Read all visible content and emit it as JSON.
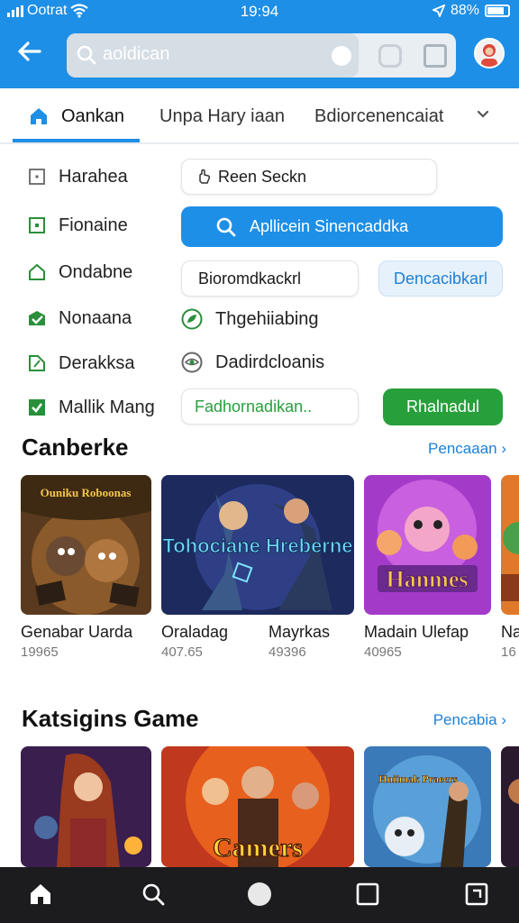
{
  "status": {
    "carrier": "Ootrat",
    "time": "19:94",
    "battery": "88%"
  },
  "search": {
    "value": "aoldican"
  },
  "tabs": [
    {
      "label": "Oankan"
    },
    {
      "label": "Unpa Hary iaan"
    },
    {
      "label": "Bdiorcenencaiat"
    }
  ],
  "categories": [
    {
      "label": "Harahea",
      "icon": "square-icon"
    },
    {
      "label": "Fionaine",
      "icon": "square-dot-icon"
    },
    {
      "label": "Ondabne",
      "icon": "house-outline-icon"
    },
    {
      "label": "Nonaana",
      "icon": "check-envelope-icon"
    },
    {
      "label": "Derakksa",
      "icon": "tag-icon"
    },
    {
      "label": "Mallik Mang",
      "icon": "check-box-icon"
    }
  ],
  "controls": {
    "input1": "Reen Seckn",
    "primary_button": "Apllicein Sinencaddka",
    "input2": "Bioromdkackrl",
    "secondary_button": "Dencacibkarl",
    "option1": "Thgehiiabing",
    "option2": "Dadirdcloanis",
    "input3": "Fadhornadikan..",
    "green_button": "Rhalnadul"
  },
  "sections": {
    "featured": {
      "title": "Canberke",
      "link": "Pencaaan",
      "games": [
        {
          "name": "Genabar Uarda",
          "sub": "19965",
          "art": "Ouniku Roboonas"
        },
        {
          "name": "Oraladag",
          "sub": "407.65",
          "art": "Tohociane Hreberne"
        },
        {
          "name": "Mayrkas",
          "sub": "49396"
        },
        {
          "name": "Madain Ulefap",
          "sub": "40965",
          "art": "Hanmes"
        },
        {
          "name": "Na",
          "sub": "16"
        }
      ]
    },
    "games": {
      "title": "Katsigins Game",
      "link": "Pencabia",
      "games": [
        {
          "name": "",
          "sub": ""
        },
        {
          "name": "",
          "sub": "",
          "art": "Camers"
        },
        {
          "name": "",
          "sub": "",
          "art": "Hniimak Praeers"
        }
      ]
    }
  },
  "colors": {
    "accent": "#1e8fe6",
    "green": "#27a03b",
    "link": "#1e7fd4",
    "bottom_nav": "#1c1c1e"
  }
}
